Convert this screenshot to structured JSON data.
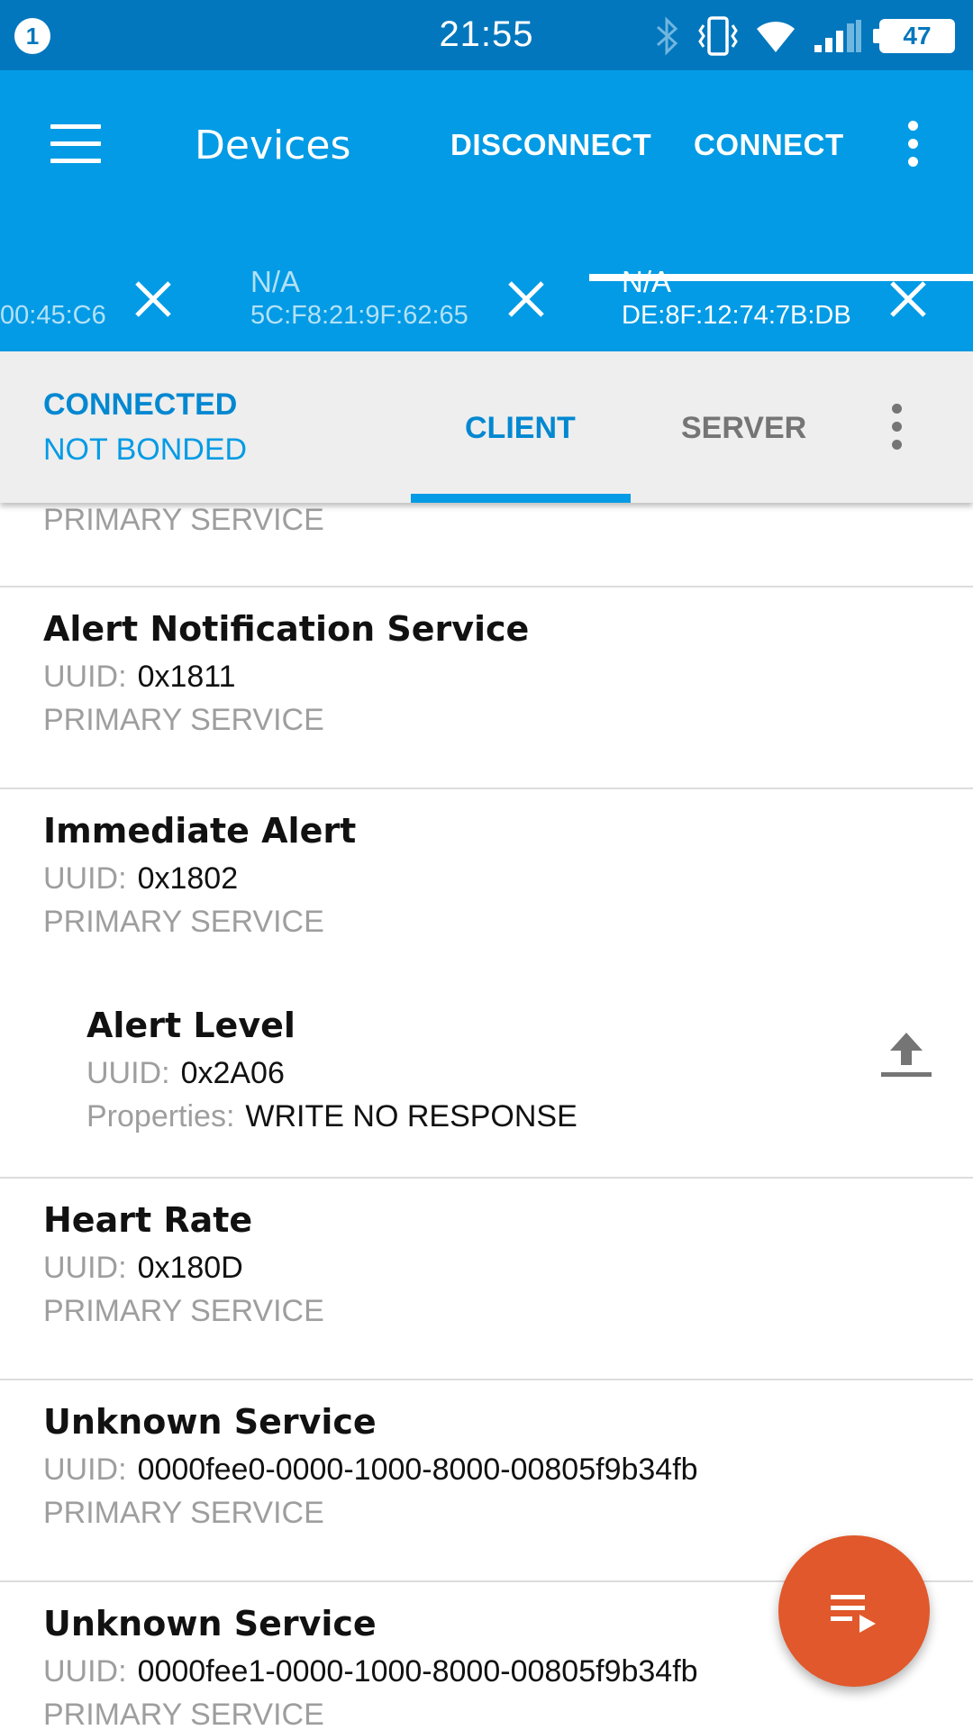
{
  "status_bar": {
    "notification_count": "1",
    "time": "21:55",
    "battery": "47",
    "icons": [
      "bluetooth-icon",
      "vibrate-icon",
      "wifi-icon",
      "signal-icon"
    ]
  },
  "app_bar": {
    "title": "Devices",
    "disconnect_label": "DISCONNECT",
    "connect_label": "CONNECT"
  },
  "device_tabs": [
    {
      "name": "",
      "address": "00:45:C6",
      "active": false
    },
    {
      "name": "N/A",
      "address": "5C:F8:21:9F:62:65",
      "active": false
    },
    {
      "name": "N/A",
      "address": "DE:8F:12:74:7B:DB",
      "active": true
    }
  ],
  "connection": {
    "state": "CONNECTED",
    "bond": "NOT BONDED"
  },
  "sub_tabs": {
    "client": "CLIENT",
    "server": "SERVER",
    "active": "client"
  },
  "list": {
    "uuid_label": "UUID:",
    "properties_label": "Properties:",
    "partial_type": "PRIMARY SERVICE",
    "items": [
      {
        "name": "Alert Notification Service",
        "uuid": "0x1811",
        "type": "PRIMARY SERVICE"
      },
      {
        "name": "Immediate Alert",
        "uuid": "0x1802",
        "type": "PRIMARY SERVICE"
      },
      {
        "name": "Alert Level",
        "uuid": "0x2A06",
        "properties": "WRITE NO RESPONSE",
        "characteristic": true
      },
      {
        "name": "Heart Rate",
        "uuid": "0x180D",
        "type": "PRIMARY SERVICE"
      },
      {
        "name": "Unknown Service",
        "uuid": "0000fee0-0000-1000-8000-00805f9b34fb",
        "type": "PRIMARY SERVICE"
      },
      {
        "name": "Unknown Service",
        "uuid": "0000fee1-0000-1000-8000-00805f9b34fb",
        "type": "PRIMARY SERVICE"
      }
    ]
  },
  "colors": {
    "status_bar": "#0277bd",
    "app_bar": "#039be5",
    "accent": "#0288d1",
    "fab": "#e0582b"
  }
}
